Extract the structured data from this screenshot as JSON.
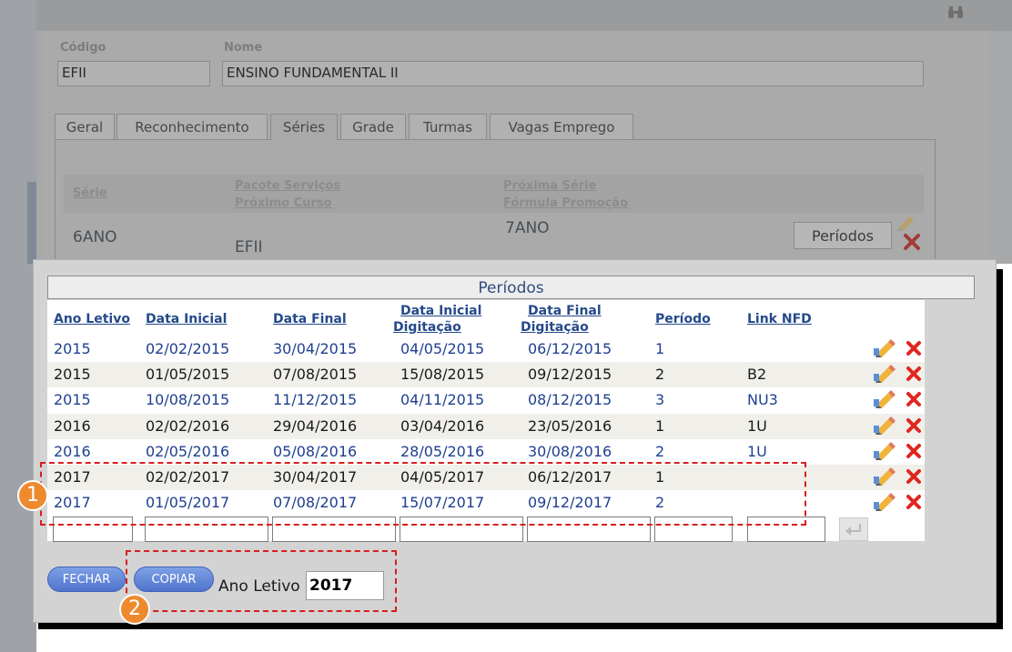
{
  "background_form": {
    "codigo_label": "Código",
    "codigo_value": "EFII",
    "nome_label": "Nome",
    "nome_value": "ENSINO FUNDAMENTAL II",
    "tabs": [
      "Geral",
      "Reconhecimento",
      "Séries",
      "Grade",
      "Turmas",
      "Vagas Emprego"
    ],
    "active_tab": "Séries",
    "series_table": {
      "col_serie": "Série",
      "col_pacote": "Pacote Serviços",
      "col_proximo_curso": "Próximo Curso",
      "col_proxima_serie": "Próxima Série",
      "col_formula": "Fórmula Promoção",
      "row_serie": "6ANO",
      "row_curso": "EFII",
      "row_proxima": "7ANO",
      "periodos_button": "Períodos"
    }
  },
  "modal": {
    "title": "Períodos",
    "columns": {
      "ano_letivo": "Ano Letivo",
      "data_inicial": "Data Inicial",
      "data_final": "Data Final",
      "data_inicial_digitacao_1": "Data Inicial",
      "data_inicial_digitacao_2": "Digitação",
      "data_final_digitacao_1": "Data Final",
      "data_final_digitacao_2": "Digitação",
      "periodo": "Período",
      "link_nfd": "Link NFD"
    },
    "rows": [
      {
        "ano": "2015",
        "ini": "02/02/2015",
        "fim": "30/04/2015",
        "ini_dig": "04/05/2015",
        "fim_dig": "06/12/2015",
        "periodo": "1",
        "link": ""
      },
      {
        "ano": "2015",
        "ini": "01/05/2015",
        "fim": "07/08/2015",
        "ini_dig": "15/08/2015",
        "fim_dig": "09/12/2015",
        "periodo": "2",
        "link": "B2"
      },
      {
        "ano": "2015",
        "ini": "10/08/2015",
        "fim": "11/12/2015",
        "ini_dig": "04/11/2015",
        "fim_dig": "08/12/2015",
        "periodo": "3",
        "link": "NU3"
      },
      {
        "ano": "2016",
        "ini": "02/02/2016",
        "fim": "29/04/2016",
        "ini_dig": "03/04/2016",
        "fim_dig": "23/05/2016",
        "periodo": "1",
        "link": "1U"
      },
      {
        "ano": "2016",
        "ini": "02/05/2016",
        "fim": "05/08/2016",
        "ini_dig": "28/05/2016",
        "fim_dig": "30/08/2016",
        "periodo": "2",
        "link": "1U"
      },
      {
        "ano": "2017",
        "ini": "02/02/2017",
        "fim": "30/04/2017",
        "ini_dig": "04/05/2017",
        "fim_dig": "06/12/2017",
        "periodo": "1",
        "link": ""
      },
      {
        "ano": "2017",
        "ini": "01/05/2017",
        "fim": "07/08/2017",
        "ini_dig": "15/07/2017",
        "fim_dig": "09/12/2017",
        "periodo": "2",
        "link": ""
      }
    ],
    "buttons": {
      "fechar": "FECHAR",
      "copiar": "COPIAR"
    },
    "ano_letivo_label": "Ano Letivo",
    "ano_letivo_value": "2017"
  },
  "annotations": {
    "badge_1": "1",
    "badge_2": "2"
  },
  "colors": {
    "link_blue": "#1f3f8f",
    "delete_red": "#e0261f",
    "annotation_red": "#d51f1f",
    "badge_orange": "#ee8a2e"
  }
}
